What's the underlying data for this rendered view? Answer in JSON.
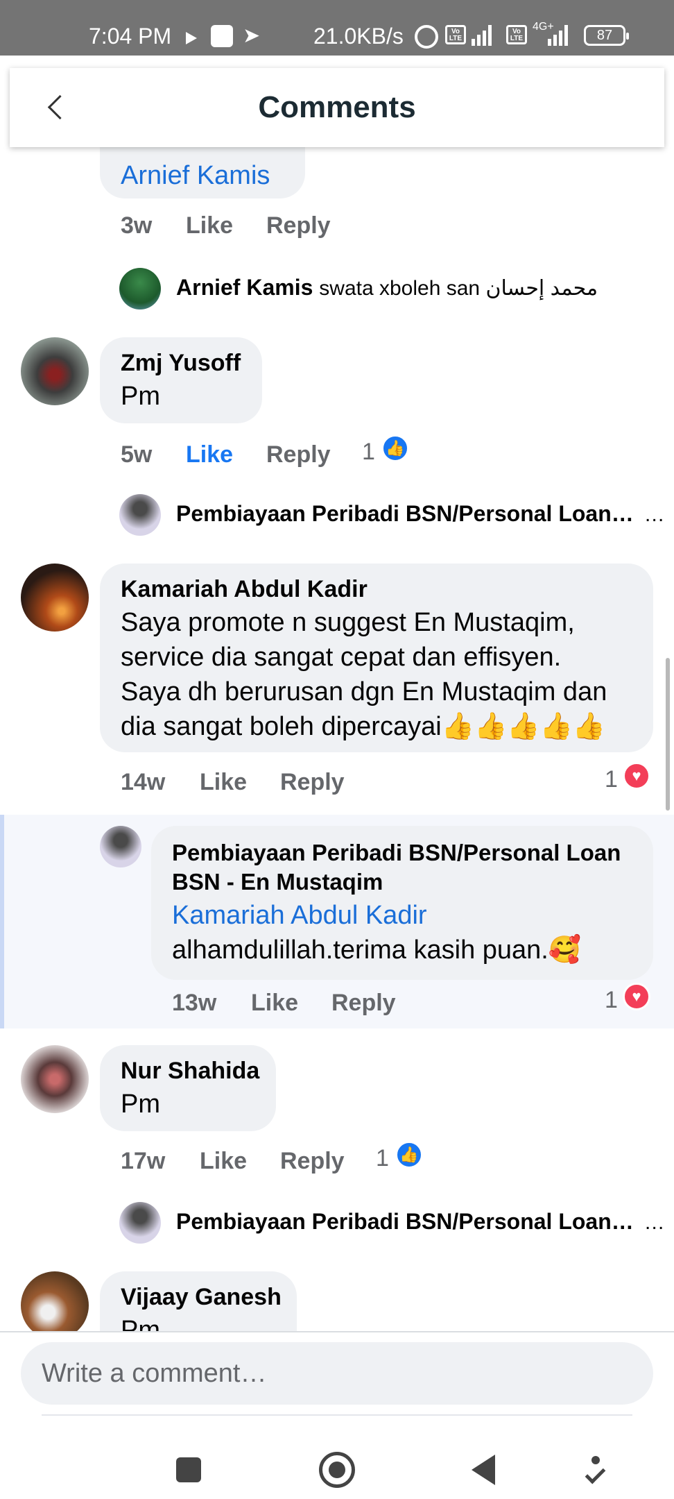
{
  "status_bar": {
    "time": "7:04 PM",
    "network_speed": "21.0KB/s",
    "battery": "87",
    "network_type": "4G+"
  },
  "header": {
    "title": "Comments"
  },
  "comments": [
    {
      "partial_tag": "Arnief Kamis",
      "age": "3w",
      "like_label": "Like",
      "reply_label": "Reply",
      "reply_preview": {
        "author": "Arnief Kamis",
        "text": "swata xboleh san محمد إحسان"
      }
    },
    {
      "author": "Zmj Yusoff",
      "text": "Pm",
      "age": "5w",
      "like_label": "Like",
      "reply_label": "Reply",
      "reaction_count": "1",
      "reaction": "like",
      "liked_by_viewer": true,
      "reply_preview": {
        "author": "Pembiayaan Peribadi BSN/Personal Loan…",
        "more": "…"
      }
    },
    {
      "author": "Kamariah Abdul Kadir",
      "text_lines": [
        "Saya promote n suggest En Mustaqim,",
        "service dia sangat cepat dan effisyen.",
        "Saya dh berurusan dgn En Mustaqim dan",
        "dia sangat boleh dipercayai👍👍👍👍👍"
      ],
      "age": "14w",
      "like_label": "Like",
      "reply_label": "Reply",
      "reaction_count": "1",
      "reaction": "love",
      "reply": {
        "author_lines": [
          "Pembiayaan Peribadi BSN/Personal Loan",
          "BSN - En Mustaqim"
        ],
        "tag": "Kamariah Abdul Kadir",
        "text": "alhamdulillah.terima kasih puan.🥰",
        "age": "13w",
        "like_label": "Like",
        "reply_label": "Reply",
        "reaction_count": "1",
        "reaction": "love"
      }
    },
    {
      "author": "Nur Shahida",
      "text": "Pm",
      "age": "17w",
      "like_label": "Like",
      "reply_label": "Reply",
      "reaction_count": "1",
      "reaction": "like",
      "reply_preview": {
        "author": "Pembiayaan Peribadi BSN/Personal Loan…",
        "more": "…"
      }
    },
    {
      "author": "Vijaay Ganesh",
      "text": "Pm"
    }
  ],
  "composer": {
    "placeholder": "Write a comment…"
  },
  "colors": {
    "accent": "#1877f2",
    "love": "#f33e58",
    "bubble": "#eff1f4",
    "status_bar": "#747474",
    "tag_link": "#1a6ed8"
  },
  "icons": {
    "like_badge": "thumbs-up-icon",
    "love_badge": "heart-icon",
    "back": "chevron-left-icon"
  }
}
